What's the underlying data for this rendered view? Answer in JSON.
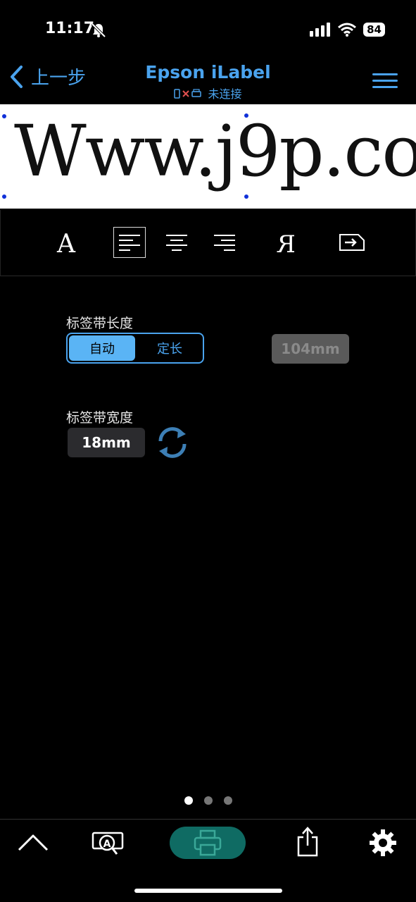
{
  "status": {
    "time": "11:17",
    "battery": "84"
  },
  "nav": {
    "back_label": "上一步",
    "title": "Epson iLabel",
    "connection_status": "未连接"
  },
  "preview": {
    "text": "Www.j9p.co"
  },
  "toolbar": {
    "items": [
      "font-icon",
      "align-left-icon",
      "align-center-icon",
      "align-right-icon",
      "mirror-text-icon",
      "frame-icon"
    ]
  },
  "tape_length": {
    "label": "标签带长度",
    "auto_label": "自动",
    "fixed_label": "定长",
    "value": "104mm"
  },
  "tape_width": {
    "label": "标签带宽度",
    "value": "18mm"
  },
  "pager": {
    "pages": 3,
    "current": 1
  },
  "bottom_nav": {
    "items": [
      "collapse-icon",
      "preview-search-icon",
      "print-icon",
      "share-icon",
      "settings-icon"
    ]
  },
  "colors": {
    "accent": "#4aa3ee",
    "segment_selected": "#5ab4f5",
    "print_button": "#0f6b63",
    "handle": "#1030d8"
  }
}
